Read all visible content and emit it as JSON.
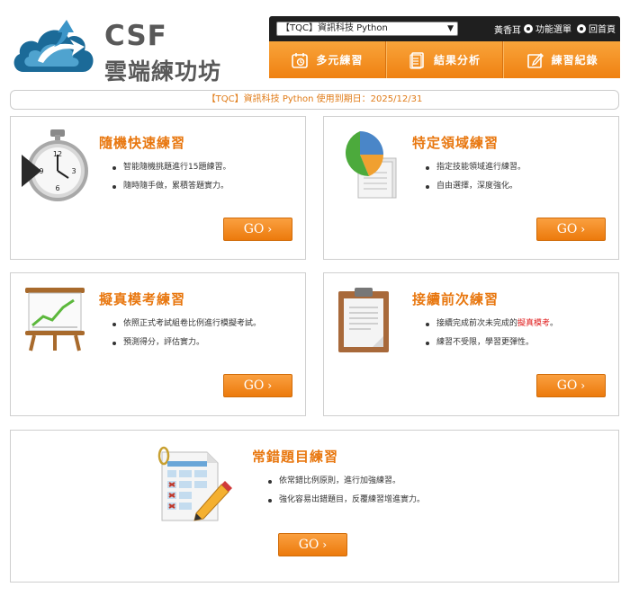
{
  "logo": {
    "line1": "CSF",
    "line2": "雲端練功坊"
  },
  "topbar": {
    "course_select": "【TQC】資訊科技 Python",
    "user_name": "黃香耳",
    "function_menu": "功能選單",
    "home": "回首頁"
  },
  "nav": {
    "items": [
      {
        "label": "多元練習",
        "icon": "calendar-icon"
      },
      {
        "label": "結果分析",
        "icon": "document-icon"
      },
      {
        "label": "練習紀錄",
        "icon": "edit-icon"
      }
    ]
  },
  "notice": "【TQC】資訊科技 Python 使用到期日：2025/12/31",
  "cards": {
    "random": {
      "title": "隨機快速練習",
      "bullets": [
        "智能隨機挑題進行15題練習。",
        "隨時隨手做，累積答題實力。"
      ],
      "go": "GO"
    },
    "domain": {
      "title": "特定領域練習",
      "bullets": [
        "指定技能領域進行練習。",
        "自由選擇，深度強化。"
      ],
      "go": "GO"
    },
    "mock": {
      "title": "擬真模考練習",
      "bullets": [
        "依照正式考試組卷比例進行模擬考試。",
        "預測得分，評估實力。"
      ],
      "go": "GO"
    },
    "resume": {
      "title": "接續前次練習",
      "bullet1_pre": "接續完成前次未完成的",
      "bullet1_highlight": "擬真模考",
      "bullet1_post": "。",
      "bullet2": "練習不受限，學習更彈性。",
      "go": "GO"
    },
    "mistakes": {
      "title": "常錯題目練習",
      "bullets": [
        "依常錯比例原則，進行加強練習。",
        "強化容易出錯題目，反覆練習增進實力。"
      ],
      "go": "GO"
    }
  },
  "colors": {
    "accent": "#e8770f",
    "nav_bg": "#f29020",
    "topbar_bg": "#1f1f1f",
    "highlight": "#e02020"
  }
}
